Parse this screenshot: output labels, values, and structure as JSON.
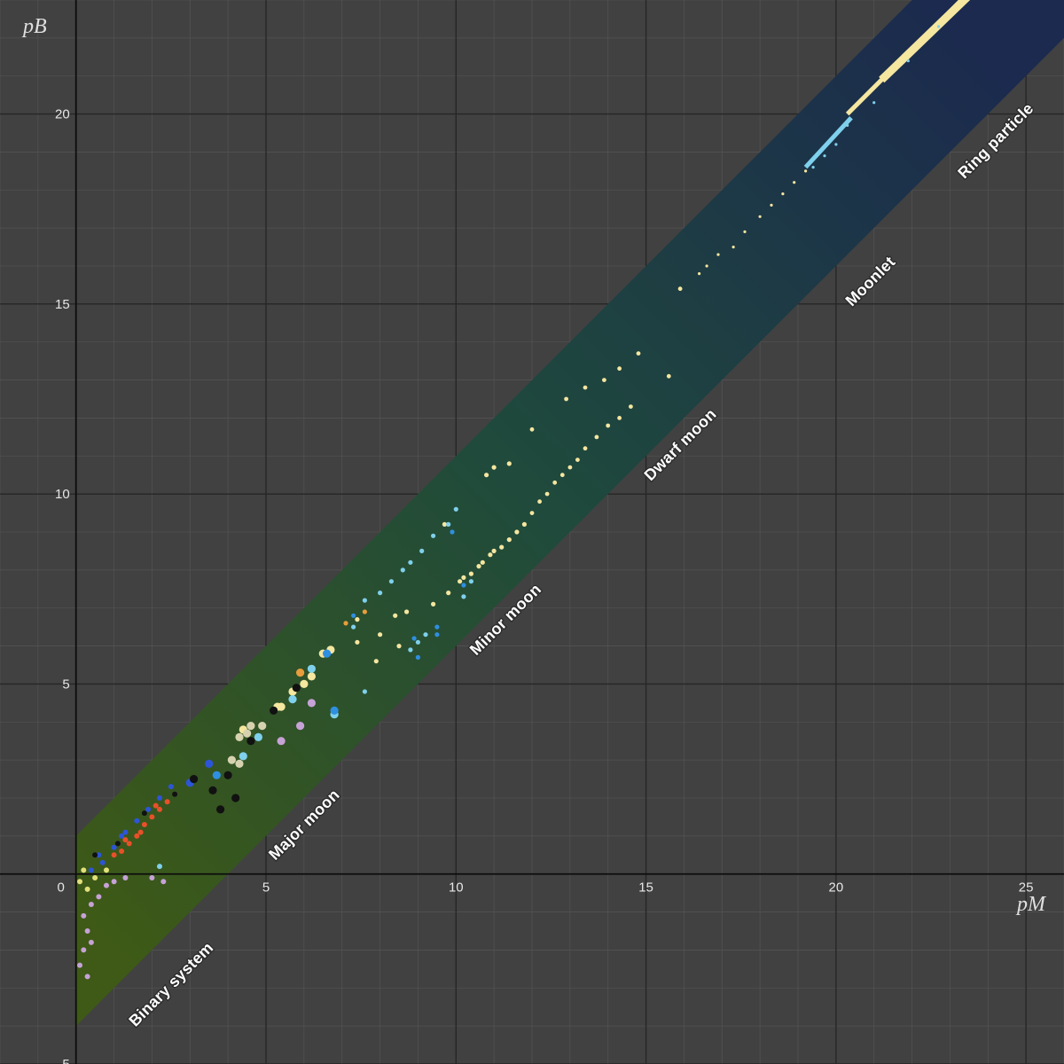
{
  "chart_data": {
    "type": "scatter",
    "xlabel": "pM",
    "ylabel": "pB",
    "xlim": [
      -2,
      26
    ],
    "ylim": [
      -5,
      23
    ],
    "x_ticks": [
      0,
      5,
      10,
      15,
      20,
      25
    ],
    "y_ticks": [
      -5,
      5,
      10,
      15,
      20
    ],
    "grid": true,
    "band": {
      "slope": 1,
      "intercept_upper": 1,
      "intercept_lower": -4,
      "colors": {
        "bottom": "#3e5a16",
        "middle": "#1f4a3c",
        "top": "#1b2a4e"
      }
    },
    "regions": [
      {
        "label": "Binary system",
        "x": 2.6,
        "y": -3.0
      },
      {
        "label": "Major moon",
        "x": 6.1,
        "y": 1.2
      },
      {
        "label": "Minor moon",
        "x": 11.4,
        "y": 6.6
      },
      {
        "label": "Dwarf moon",
        "x": 16.0,
        "y": 11.2
      },
      {
        "label": "Moonlet",
        "x": 21.0,
        "y": 15.5
      },
      {
        "label": "Ring particle",
        "x": 24.3,
        "y": 19.2
      }
    ],
    "series": [
      {
        "color": "#f5e6a0",
        "points": [
          [
            4.4,
            3.8
          ],
          [
            5.4,
            4.4
          ],
          [
            5.3,
            4.4
          ],
          [
            5.7,
            4.8
          ],
          [
            6.0,
            5.0
          ],
          [
            6.2,
            5.2
          ],
          [
            6.5,
            5.8
          ],
          [
            6.7,
            5.9
          ],
          [
            7.4,
            6.7
          ],
          [
            8.0,
            6.3
          ],
          [
            8.4,
            6.8
          ],
          [
            8.7,
            6.9
          ],
          [
            9.4,
            7.1
          ],
          [
            9.8,
            7.4
          ],
          [
            10.1,
            7.7
          ],
          [
            10.2,
            7.8
          ],
          [
            10.4,
            7.9
          ],
          [
            10.6,
            8.1
          ],
          [
            10.7,
            8.2
          ],
          [
            10.9,
            8.4
          ],
          [
            11.0,
            8.5
          ],
          [
            11.2,
            8.6
          ],
          [
            11.4,
            8.8
          ],
          [
            11.6,
            9.0
          ],
          [
            11.8,
            9.2
          ],
          [
            12.0,
            9.5
          ],
          [
            12.2,
            9.8
          ],
          [
            12.4,
            10.0
          ],
          [
            12.6,
            10.3
          ],
          [
            12.8,
            10.5
          ],
          [
            13.0,
            10.7
          ],
          [
            13.2,
            10.9
          ],
          [
            13.4,
            11.2
          ],
          [
            13.7,
            11.5
          ],
          [
            14.0,
            11.8
          ],
          [
            14.3,
            12.0
          ],
          [
            14.6,
            12.3
          ],
          [
            15.6,
            13.1
          ],
          [
            14.8,
            13.7
          ],
          [
            14.3,
            13.3
          ],
          [
            13.9,
            13.0
          ],
          [
            13.4,
            12.8
          ],
          [
            12.9,
            12.5
          ],
          [
            12.0,
            11.7
          ],
          [
            11.4,
            10.8
          ],
          [
            11.0,
            10.7
          ],
          [
            10.8,
            10.5
          ],
          [
            9.7,
            9.2
          ],
          [
            7.4,
            6.1
          ],
          [
            7.9,
            5.6
          ],
          [
            8.5,
            6.0
          ],
          [
            15.9,
            15.4
          ],
          [
            17.3,
            16.5
          ],
          [
            16.4,
            15.8
          ],
          [
            16.6,
            16.0
          ],
          [
            16.9,
            16.3
          ],
          [
            17.6,
            16.9
          ],
          [
            18.0,
            17.3
          ],
          [
            18.3,
            17.6
          ],
          [
            18.6,
            17.9
          ],
          [
            18.9,
            18.2
          ],
          [
            19.2,
            18.5
          ]
        ]
      },
      {
        "color": "#7fd0ec",
        "points": [
          [
            2.2,
            0.2
          ],
          [
            4.4,
            3.1
          ],
          [
            4.8,
            3.6
          ],
          [
            5.7,
            4.6
          ],
          [
            6.2,
            5.4
          ],
          [
            7.3,
            6.5
          ],
          [
            7.6,
            7.2
          ],
          [
            8.0,
            7.4
          ],
          [
            8.3,
            7.7
          ],
          [
            8.6,
            8.0
          ],
          [
            8.8,
            8.2
          ],
          [
            9.1,
            8.5
          ],
          [
            9.4,
            8.9
          ],
          [
            9.8,
            9.2
          ],
          [
            10.0,
            9.6
          ],
          [
            10.2,
            7.3
          ],
          [
            10.4,
            7.7
          ],
          [
            9.2,
            6.3
          ],
          [
            9.0,
            6.1
          ],
          [
            8.8,
            5.9
          ],
          [
            7.6,
            4.8
          ],
          [
            6.8,
            4.2
          ],
          [
            19.4,
            18.6
          ],
          [
            19.7,
            18.9
          ],
          [
            20.0,
            19.2
          ],
          [
            20.3,
            19.7
          ],
          [
            21.0,
            20.3
          ],
          [
            21.9,
            21.4
          ],
          [
            22.7,
            22.3
          ]
        ]
      },
      {
        "color": "#2f8fe0",
        "points": [
          [
            3.7,
            2.6
          ],
          [
            6.6,
            5.8
          ],
          [
            7.3,
            6.8
          ],
          [
            6.8,
            4.3
          ],
          [
            9.0,
            5.7
          ],
          [
            8.9,
            6.2
          ],
          [
            9.5,
            6.3
          ],
          [
            9.9,
            9.0
          ],
          [
            9.5,
            6.5
          ],
          [
            10.2,
            7.6
          ]
        ]
      },
      {
        "color": "#e89d3c",
        "points": [
          [
            7.6,
            6.9
          ],
          [
            7.1,
            6.6
          ],
          [
            5.9,
            5.3
          ]
        ]
      },
      {
        "color": "#c6a2d6",
        "points": [
          [
            0.2,
            -1.1
          ],
          [
            0.4,
            -0.8
          ],
          [
            0.6,
            -0.6
          ],
          [
            0.8,
            -0.3
          ],
          [
            1.0,
            -0.2
          ],
          [
            1.3,
            -0.1
          ],
          [
            2.0,
            -0.1
          ],
          [
            2.3,
            -0.2
          ],
          [
            5.4,
            3.5
          ],
          [
            5.9,
            3.9
          ],
          [
            6.2,
            4.5
          ],
          [
            0.3,
            -1.5
          ],
          [
            0.2,
            -2.0
          ],
          [
            0.4,
            -1.8
          ],
          [
            0.1,
            -2.4
          ],
          [
            0.3,
            -2.7
          ]
        ]
      },
      {
        "color": "#e8502a",
        "points": [
          [
            1.2,
            0.6
          ],
          [
            1.4,
            0.8
          ],
          [
            1.6,
            1.0
          ],
          [
            1.8,
            1.3
          ],
          [
            2.0,
            1.5
          ],
          [
            2.2,
            1.7
          ],
          [
            2.4,
            1.9
          ],
          [
            1.0,
            0.5
          ],
          [
            1.3,
            0.9
          ],
          [
            1.7,
            1.1
          ],
          [
            2.1,
            1.8
          ]
        ]
      },
      {
        "color": "#2d55d8",
        "points": [
          [
            0.4,
            0.1
          ],
          [
            0.7,
            0.3
          ],
          [
            1.0,
            0.7
          ],
          [
            1.3,
            1.1
          ],
          [
            1.6,
            1.4
          ],
          [
            1.9,
            1.7
          ],
          [
            2.2,
            2.0
          ],
          [
            2.5,
            2.3
          ],
          [
            0.6,
            0.5
          ],
          [
            1.2,
            1.0
          ],
          [
            3.0,
            2.4
          ],
          [
            3.5,
            2.9
          ]
        ]
      },
      {
        "color": "#d6d2b0",
        "points": [
          [
            4.1,
            3.0
          ],
          [
            4.3,
            2.9
          ],
          [
            4.5,
            3.7
          ],
          [
            4.6,
            3.9
          ],
          [
            4.3,
            3.6
          ],
          [
            4.9,
            3.9
          ]
        ]
      },
      {
        "color": "#111111",
        "points": [
          [
            0.5,
            0.5
          ],
          [
            1.1,
            0.8
          ],
          [
            1.8,
            1.6
          ],
          [
            2.6,
            2.1
          ],
          [
            3.1,
            2.5
          ],
          [
            3.6,
            2.2
          ],
          [
            4.0,
            2.6
          ],
          [
            4.6,
            3.5
          ],
          [
            5.2,
            4.3
          ],
          [
            5.8,
            4.9
          ],
          [
            3.8,
            1.7
          ],
          [
            4.2,
            2.0
          ]
        ]
      },
      {
        "color": "#e2e07a",
        "points": [
          [
            0.1,
            -0.2
          ],
          [
            0.3,
            -0.4
          ],
          [
            0.5,
            -0.1
          ],
          [
            0.8,
            0.1
          ],
          [
            0.2,
            0.1
          ]
        ]
      }
    ],
    "ring_segments": [
      {
        "color": "#f5e6a0",
        "from": [
          20.3,
          20.0
        ],
        "to": [
          23.4,
          23.1
        ]
      },
      {
        "color": "#f5e6a0",
        "from": [
          21.2,
          20.9
        ],
        "to": [
          24.0,
          23.6
        ]
      },
      {
        "color": "#7fd0ec",
        "from": [
          19.2,
          18.6
        ],
        "to": [
          20.4,
          19.9
        ]
      }
    ]
  }
}
